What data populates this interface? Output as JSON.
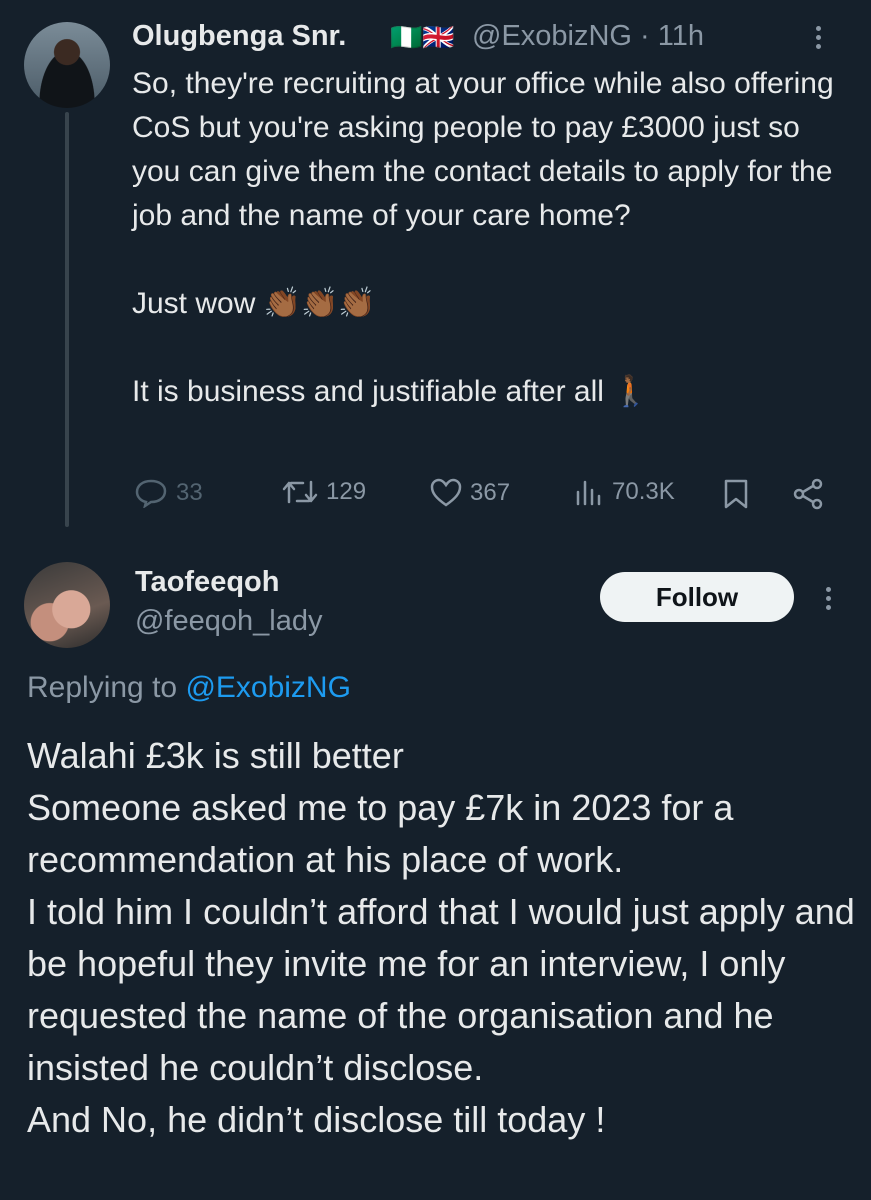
{
  "tweet": {
    "author_name": "Olugbenga Snr.",
    "author_flags": "🇳🇬🇬🇧",
    "author_handle": "@ExobizNG",
    "time": "· 11h",
    "text_paragraph_1": "So, they're recruiting at your office while also offering CoS but you're asking people to pay £3000 just so you can give them the contact details to apply for the job and the name of your care home?",
    "text_paragraph_2": "Just wow 👏🏾👏🏾👏🏾",
    "text_paragraph_3": "It is business and justifiable after all 🚶🏾",
    "replies": "33",
    "retweets": "129",
    "likes": "367",
    "views": "70.3K"
  },
  "reply": {
    "author_name": "Taofeeqoh",
    "author_handle": "@feeqoh_lady",
    "follow_label": "Follow",
    "replying_prefix": "Replying to",
    "replying_to": "@ExobizNG",
    "lines": [
      "Walahi £3k is still better",
      "Someone asked me to pay £7k in 2023 for a recommendation at his place of work.",
      "I told him I couldn’t afford that I would just apply and be hopeful they invite me for an interview, I only requested the name of the organisation and he insisted he couldn’t disclose.",
      "And No, he didn’t disclose till today !"
    ]
  },
  "colors": {
    "background": "#15202b",
    "text": "#e7e9ea",
    "muted": "#8b98a5",
    "link": "#1d9bf0",
    "follow_bg": "#eff3f4"
  }
}
